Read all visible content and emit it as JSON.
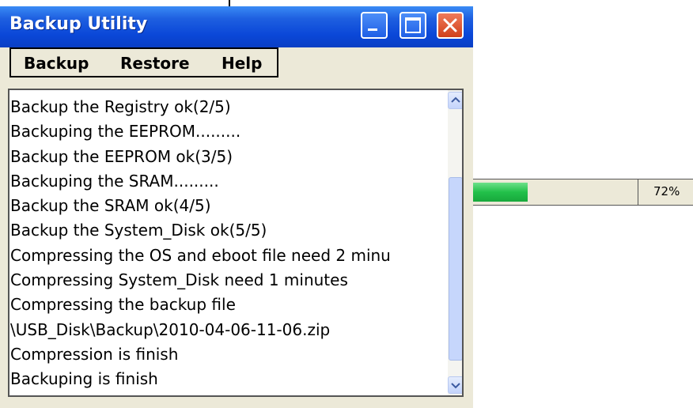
{
  "window": {
    "title": "Backup Utility",
    "menu": [
      "Backup",
      "Restore",
      "Help"
    ]
  },
  "log": {
    "lines": [
      "Backup the Registry ok(2/5)",
      "Backuping the EEPROM.........",
      "Backup the EEPROM ok(3/5)",
      "Backuping the SRAM.........",
      "Backup the SRAM ok(4/5)",
      "Backup the System_Disk ok(5/5)",
      "Compressing the OS and eboot file need 2 minu",
      "Compressing System_Disk need 1 minutes",
      "Compressing the backup file",
      "\\USB_Disk\\Backup\\2010-04-06-11-06.zip",
      "Compression is finish",
      "Backuping is finish"
    ]
  },
  "progress": {
    "label": "72%",
    "fill_fraction": 0.33,
    "fill_color": "#22c04a"
  },
  "icons": {
    "minimize": "minimize-icon",
    "maximize": "maximize-icon",
    "close": "close-icon",
    "scroll_up": "arrow-up-icon",
    "scroll_down": "arrow-down-icon"
  }
}
